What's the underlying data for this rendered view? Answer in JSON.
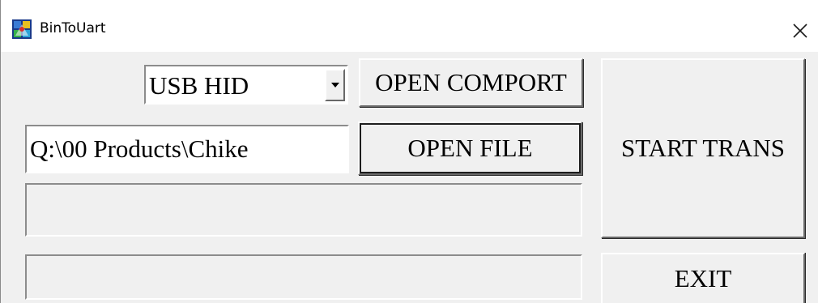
{
  "window": {
    "title": "BinToUart",
    "close_glyph": "×",
    "icon_name": "app-icon"
  },
  "port": {
    "selected": "USB HID",
    "open_label": "OPEN COMPORT"
  },
  "file": {
    "path": "Q:\\00 Products\\Chike",
    "open_label": "OPEN FILE"
  },
  "actions": {
    "start_label": "START TRANS",
    "exit_label": "EXIT"
  },
  "status": {
    "line1": "",
    "line2": ""
  },
  "colors": {
    "face": "#f0f0f0",
    "titlebar": "#ffffff",
    "shadow": "#696969",
    "highlight": "#ffffff"
  }
}
